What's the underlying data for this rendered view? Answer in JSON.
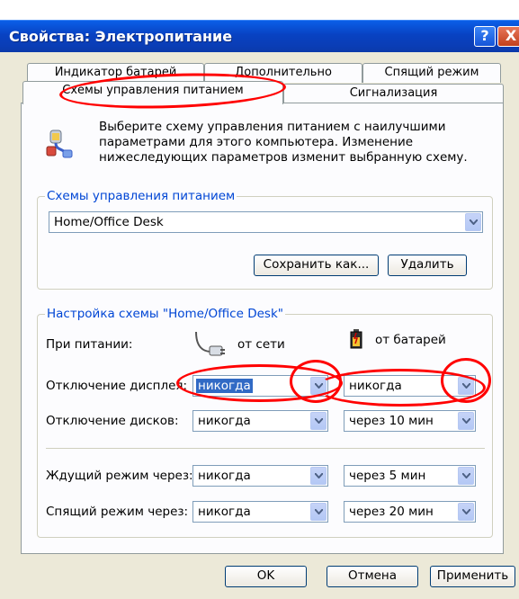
{
  "window": {
    "title": "Свойства: Электропитание",
    "help_label": "?",
    "close_label": "X"
  },
  "tabs": {
    "battery_meter": "Индикатор батарей",
    "advanced": "Дополнительно",
    "hibernate": "Спящий режим",
    "power_schemes": "Схемы управления питанием",
    "alarms": "Сигнализация"
  },
  "intro": {
    "icon": "power-plug-icon",
    "text": "Выберите схему управления питанием с наилучшими параметрами для этого компьютера. Изменение нижеследующих параметров изменит выбранную схему."
  },
  "schemes_group": {
    "legend": "Схемы управления питанием",
    "selected": "Home/Office Desk",
    "save_as": "Сохранить как...",
    "delete": "Удалить"
  },
  "settings_group": {
    "legend": "Настройка схемы \"Home/Office Desk\"",
    "when_label": "При питании:",
    "ac_label": "от сети",
    "battery_label": "от батарей",
    "rows": [
      {
        "label": "Отключение дисплея:",
        "ac": "никогда",
        "battery": "никогда"
      },
      {
        "label": "Отключение дисков:",
        "ac": "никогда",
        "battery": "через 10 мин"
      },
      {
        "label": "Ждущий режим через:",
        "ac": "никогда",
        "battery": "через 5 мин"
      },
      {
        "label": "Спящий режим через:",
        "ac": "никогда",
        "battery": "через 20 мин"
      }
    ]
  },
  "footer": {
    "ok": "OK",
    "cancel": "Отмена",
    "apply": "Применить"
  },
  "colors": {
    "titlebar": "#0842c2",
    "group_legend": "#0046d5",
    "annotation": "#ff0000",
    "selection": "#316ac5"
  }
}
